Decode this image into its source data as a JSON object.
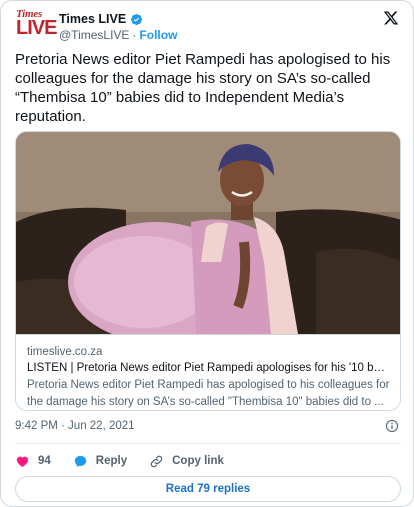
{
  "account": {
    "brand_line1": "Times",
    "brand_line2": "LIVE",
    "display_name": "Times LIVE",
    "handle": "@TimesLIVE",
    "separator": "·",
    "follow_label": "Follow",
    "brand_color": "#c0262d",
    "verified_color": "#1d9bf0"
  },
  "tweet": {
    "text": "Pretoria News editor Piet Rampedi has apologised to his colleagues for the damage his story on SA’s so-called “Thembisa 10” babies did to Independent Media’s reputation.",
    "timestamp": "9:42 PM · Jun 22, 2021"
  },
  "link_card": {
    "domain": "timeslive.co.za",
    "title": "LISTEN | Pretoria News editor Piet Rampedi apologises for his '10 babies...",
    "description": "Pretoria News editor Piet Rampedi has apologised to his colleagues for the damage his story on SA’s so-called \"Thembisa 10\" babies did to ..."
  },
  "actions": {
    "like_count": "94",
    "reply_label": "Reply",
    "copy_link_label": "Copy link",
    "read_replies_label": "Read 79 replies",
    "like_color": "#f91880",
    "reply_color": "#1d9bf0"
  },
  "icons": [
    "verified-icon",
    "x-logo-icon",
    "info-icon",
    "heart-icon",
    "reply-icon",
    "link-icon"
  ]
}
